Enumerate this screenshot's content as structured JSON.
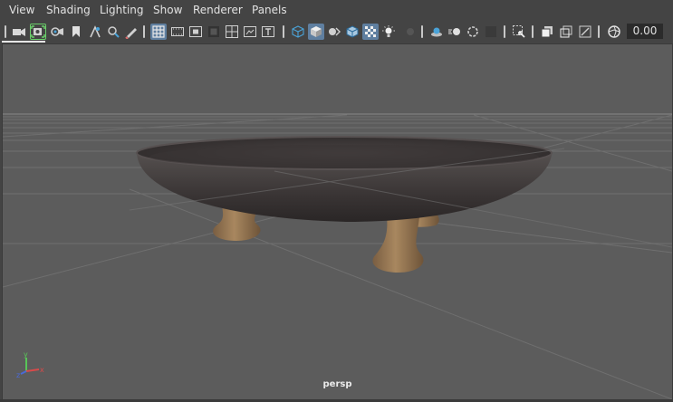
{
  "menu": {
    "items": [
      {
        "label": "View"
      },
      {
        "label": "Shading"
      },
      {
        "label": "Lighting"
      },
      {
        "label": "Show"
      },
      {
        "label": "Renderer"
      },
      {
        "label": "Panels"
      }
    ]
  },
  "toolbar": {
    "value": "0.00",
    "icons": [
      "select-camera-icon",
      "camera-attributes-icon",
      "bookmark-icon",
      "image-plane-icon",
      "pan-zoom-icon",
      "grease-pencil-icon",
      "grid-icon",
      "film-gate-icon",
      "resolution-gate-icon",
      "gate-mask-icon",
      "field-chart-icon",
      "safe-action-icon",
      "safe-title-icon",
      "wireframe-icon",
      "smooth-shade-icon",
      "wireframe-on-shaded-icon",
      "xray-icon",
      "textured-icon",
      "use-all-lights-icon",
      "shadows-icon",
      "screen-space-ao-icon",
      "motion-blur-icon",
      "multisample-aa-icon",
      "depth-of-field-icon",
      "isolate-select-icon",
      "xray-joints-icon",
      "xray-active-components-icon",
      "image-plane-toggle-icon",
      "exposure-icon"
    ]
  },
  "viewport": {
    "camera_label": "persp",
    "background": "#5c5c5c",
    "grid_color": "#7a7a7a",
    "axes": [
      "x",
      "y",
      "z"
    ]
  },
  "colors": {
    "accent_blue": "#5f7fa0",
    "highlight_green": "#6ad06a",
    "bowl": "#3e3a3a",
    "legs": "#9a7a58"
  }
}
